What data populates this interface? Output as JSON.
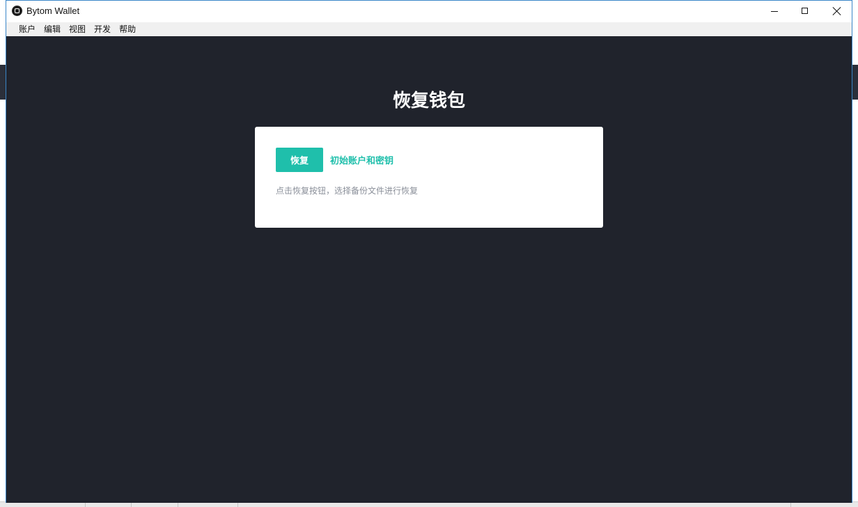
{
  "window": {
    "title": "Bytom Wallet"
  },
  "menubar": {
    "items": [
      "账户",
      "编辑",
      "视图",
      "开发",
      "帮助"
    ]
  },
  "main": {
    "page_title": "恢复钱包",
    "restore_button_label": "恢复",
    "init_link_label": "初始账户和密钥",
    "hint": "点击恢复按钮，选择备份文件进行恢复"
  },
  "colors": {
    "background": "#20232c",
    "accent": "#1fbfab",
    "card": "#ffffff",
    "hint_text": "#8a8f99"
  },
  "icons": {
    "app": "bytom-logo-icon",
    "minimize": "minimize-icon",
    "maximize": "maximize-icon",
    "close": "close-icon"
  }
}
